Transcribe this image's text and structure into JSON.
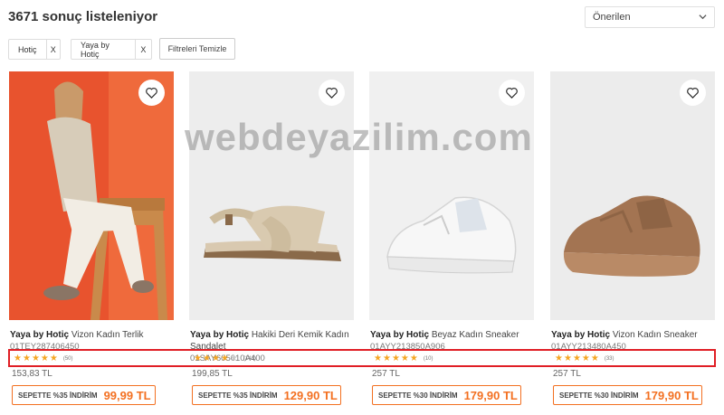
{
  "header": {
    "result_count": "3671 sonuç listeleniyor"
  },
  "sort": {
    "selected": "Önerilen"
  },
  "filters": {
    "chips": [
      {
        "label": "Hotiç",
        "remove": "X"
      },
      {
        "label": "Yaya by Hotiç",
        "remove": "X"
      }
    ],
    "clear_label": "Filtreleri Temizle"
  },
  "watermark": "webdeyazilim.com",
  "products": [
    {
      "brand": "Yaya by Hotiç",
      "name": "Vizon Kadın Terlik",
      "sku": "01TEY287406450",
      "rating": 5,
      "rating_count": "(50)",
      "list_price": "153,83 TL",
      "discount_label": "SEPETTE %35 İNDİRİM",
      "sale_price": "99,99 TL"
    },
    {
      "brand": "Yaya by Hotiç",
      "name": "Hakiki Deri Kemik Kadın Sandalet",
      "sku": "01SAY605010A400",
      "rating": 4.5,
      "rating_count": "(141)",
      "list_price": "199,85 TL",
      "discount_label": "SEPETTE %35 İNDİRİM",
      "sale_price": "129,90 TL"
    },
    {
      "brand": "Yaya by Hotiç",
      "name": "Beyaz Kadın Sneaker",
      "sku": "01AYY213850A906",
      "rating": 5,
      "rating_count": "(10)",
      "list_price": "257 TL",
      "discount_label": "SEPETTE %30 İNDİRİM",
      "sale_price": "179,90 TL"
    },
    {
      "brand": "Yaya by Hotiç",
      "name": "Vizon Kadın Sneaker",
      "sku": "01AYY213480A450",
      "rating": 5,
      "rating_count": "(33)",
      "list_price": "257 TL",
      "discount_label": "SEPETTE %30 İNDİRİM",
      "sale_price": "179,90 TL"
    }
  ],
  "colors": {
    "accent": "#f37021",
    "star": "#f5a623",
    "highlight": "#e01e25"
  }
}
